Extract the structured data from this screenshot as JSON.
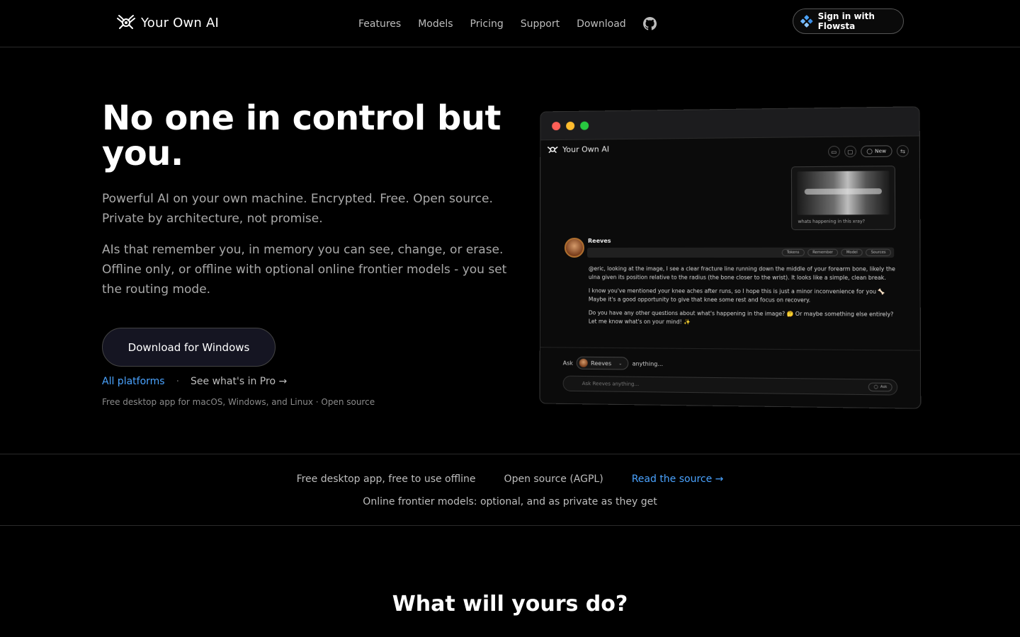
{
  "nav": {
    "brand": "Your Own AI",
    "links": [
      "Features",
      "Models",
      "Pricing",
      "Support",
      "Download"
    ],
    "signin_label": "Sign in with Flowsta"
  },
  "hero": {
    "title": "No one in control but you.",
    "p1": "Powerful AI on your own machine. Encrypted. Free. Open source. Private by architecture, not promise.",
    "p2": "AIs that remember you, in memory you can see, change, or erase. Offline only, or offline with optional online frontier models - you set the routing mode.",
    "download_label": "Download for Windows",
    "all_platforms": "All platforms",
    "separator": "·",
    "pro_link": "See what's in Pro →",
    "note": "Free desktop app for macOS, Windows, and Linux · Open source"
  },
  "mock": {
    "brand": "Your Own AI",
    "new_label": "New",
    "image_caption": "whats happening in this xray?",
    "sender": "Reeves",
    "chips": [
      "Tokens",
      "Remember",
      "Model",
      "Sources"
    ],
    "messages": [
      "@eric, looking at the image, I see a clear fracture line running down the middle of your forearm bone, likely the ulna given its position relative to the radius (the bone closer to the wrist). It looks like a simple, clean break.",
      "I know you've mentioned your knee aches after runs, so I hope this is just a minor inconvenience for you 🦴 Maybe it's a good opportunity to give that knee some rest and focus on recovery.",
      "Do you have any other questions about what's happening in the image? 🤔 Or maybe something else entirely? Let me know what's on your mind! ✨"
    ],
    "ask_prefix": "Ask",
    "ask_selected": "Reeves",
    "ask_suffix": "anything...",
    "input_placeholder": "Ask Reeves anything...",
    "send_label": "Ask",
    "traffic_colors": [
      "#ff5f57",
      "#febc2e",
      "#28c840"
    ]
  },
  "band": {
    "item1": "Free desktop app, free to use offline",
    "item2": "Open source (AGPL)",
    "item3": "Read the source →",
    "item4": "Online frontier models: optional, and as private as they get"
  },
  "section": {
    "title": "What will yours do?"
  },
  "colors": {
    "accent_blue": "#4aa3ff",
    "background": "#000000"
  }
}
